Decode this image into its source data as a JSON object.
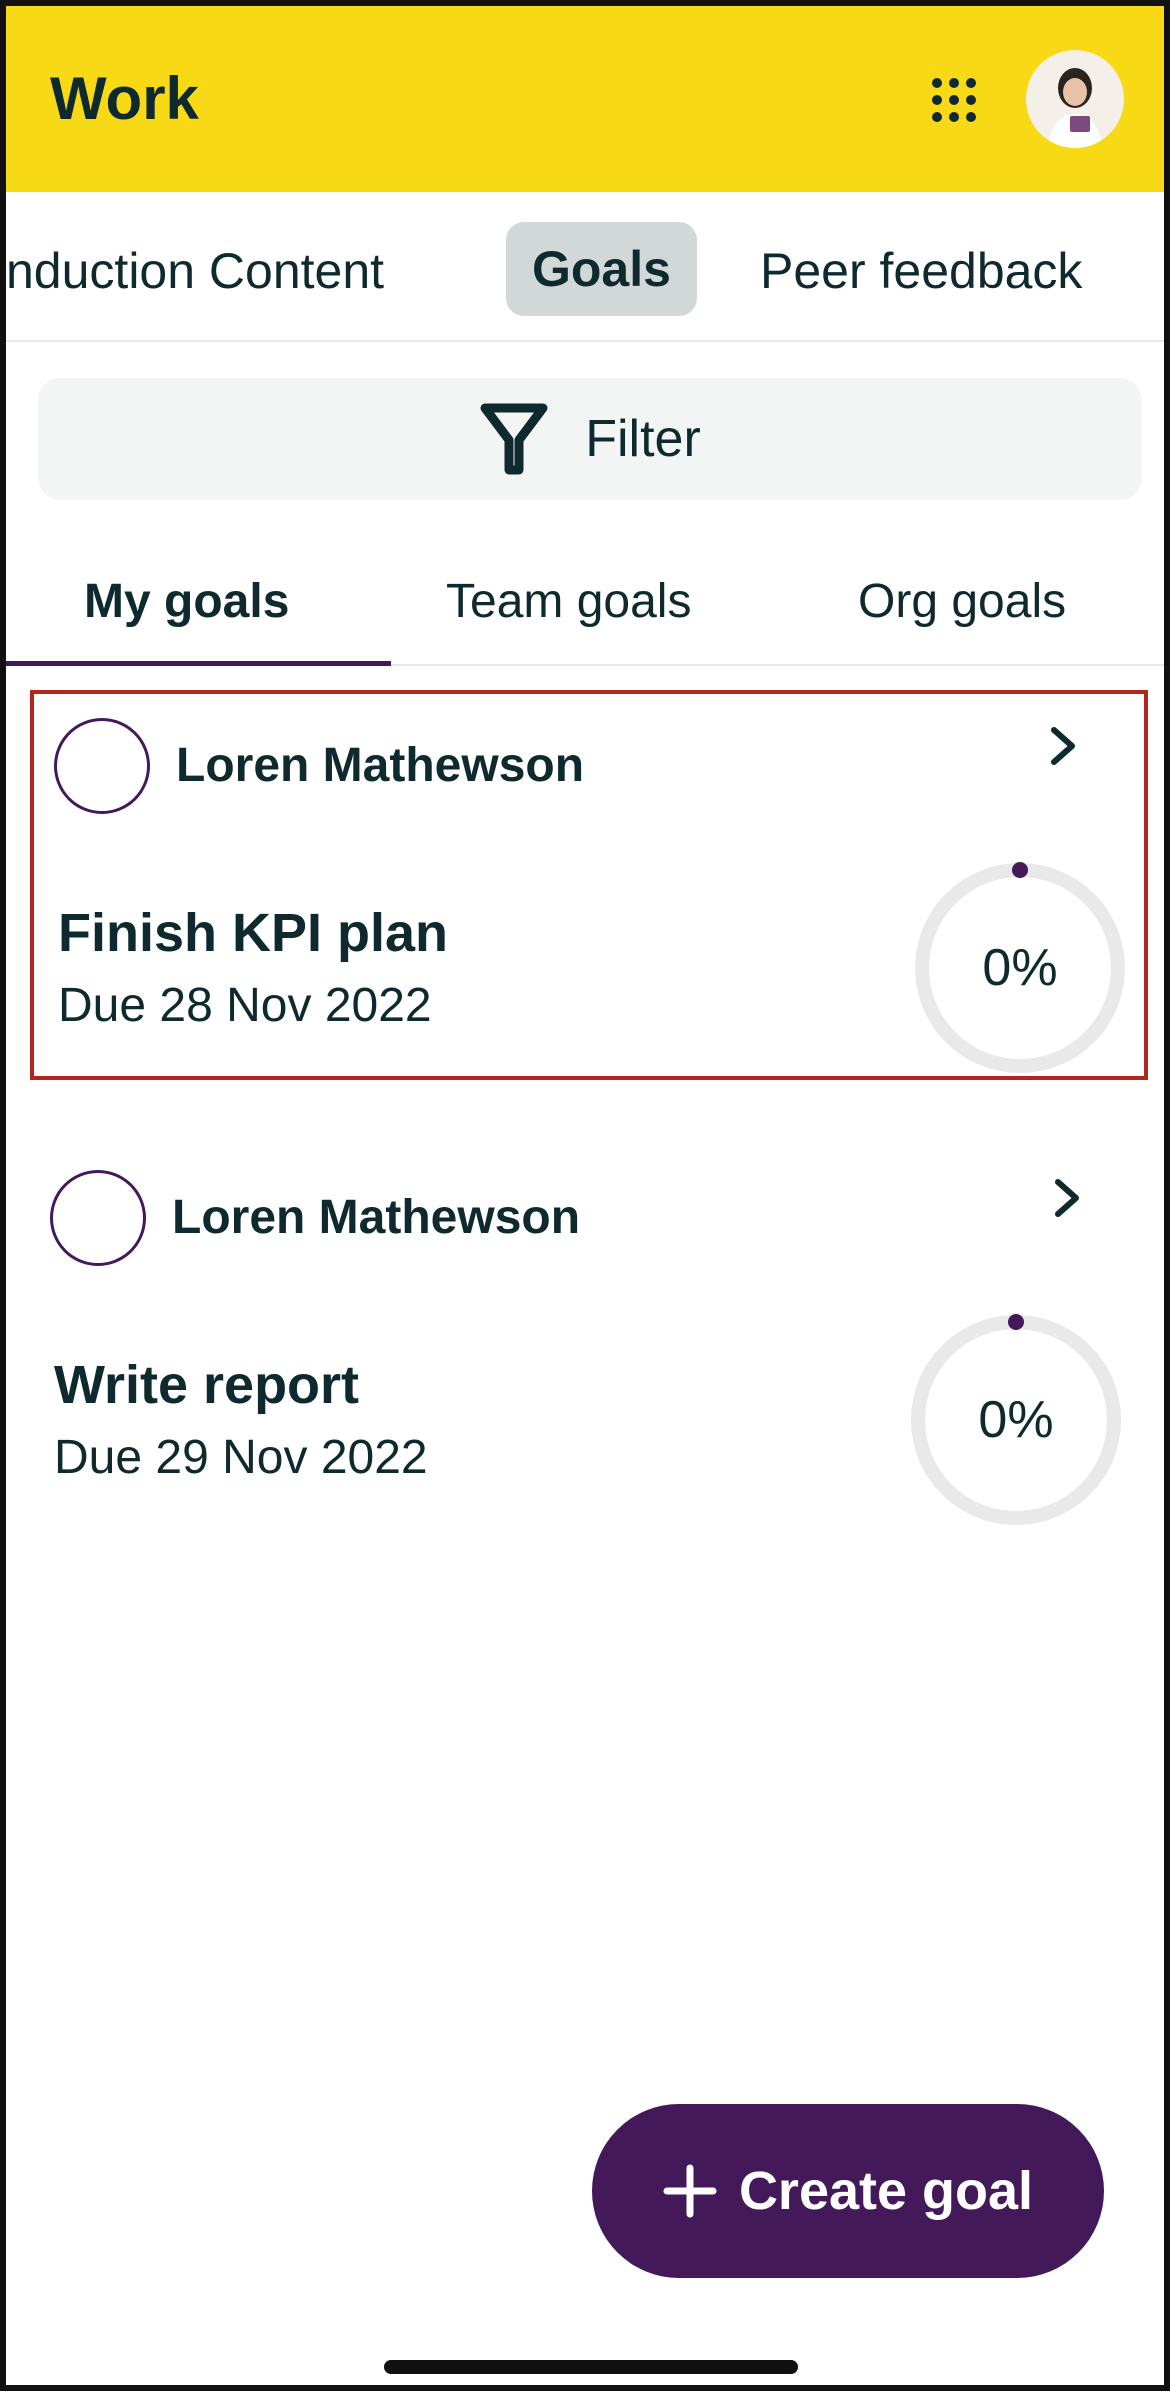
{
  "header": {
    "title": "Work",
    "apps_icon": "apps-grid-icon",
    "avatar_icon": "user-avatar"
  },
  "top_tabs": [
    {
      "label": "nduction Content"
    },
    {
      "label": "Goals",
      "active": true
    },
    {
      "label": "Peer feedback"
    }
  ],
  "filter": {
    "label": "Filter",
    "icon": "filter-icon"
  },
  "sub_tabs": [
    {
      "label": "My goals",
      "active": true
    },
    {
      "label": "Team goals"
    },
    {
      "label": "Org goals"
    }
  ],
  "goals": [
    {
      "owner": "Loren Mathewson",
      "title": "Finish KPI plan",
      "due": "Due 28 Nov 2022",
      "progress_label": "0%",
      "progress": 0,
      "highlighted": true
    },
    {
      "owner": "Loren Mathewson",
      "title": "Write report",
      "due": "Due 29 Nov 2022",
      "progress_label": "0%",
      "progress": 0,
      "highlighted": false
    }
  ],
  "create_button": {
    "label": "Create goal",
    "icon": "plus-icon"
  },
  "colors": {
    "header": "#f7d916",
    "accent": "#44195a",
    "highlight_border": "#b3261e",
    "text": "#0f2a2e"
  }
}
